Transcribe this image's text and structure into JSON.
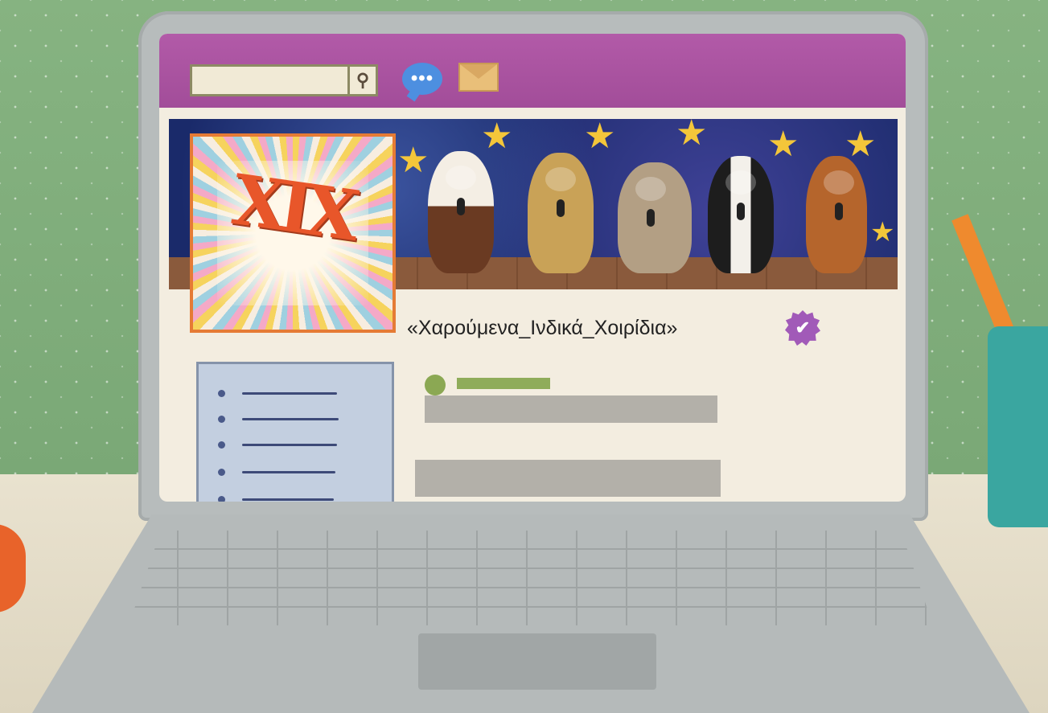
{
  "profile": {
    "avatar_text": "XIX",
    "name": "«Χαρούμενα_Ινδικά_Χοιρίδια»",
    "verified_mark": "✔"
  },
  "topbar": {
    "search_placeholder": "",
    "search_icon": "search-icon",
    "search_glyph": "⚲",
    "chat_icon": "chat-bubble-icon",
    "chat_glyph": "•••",
    "mail_icon": "envelope-icon"
  },
  "colors": {
    "topbar": "#a24d99",
    "banner_bg": "#1a2a6a",
    "verified": "#a15ab8",
    "avatar_text": "#e8562a"
  }
}
